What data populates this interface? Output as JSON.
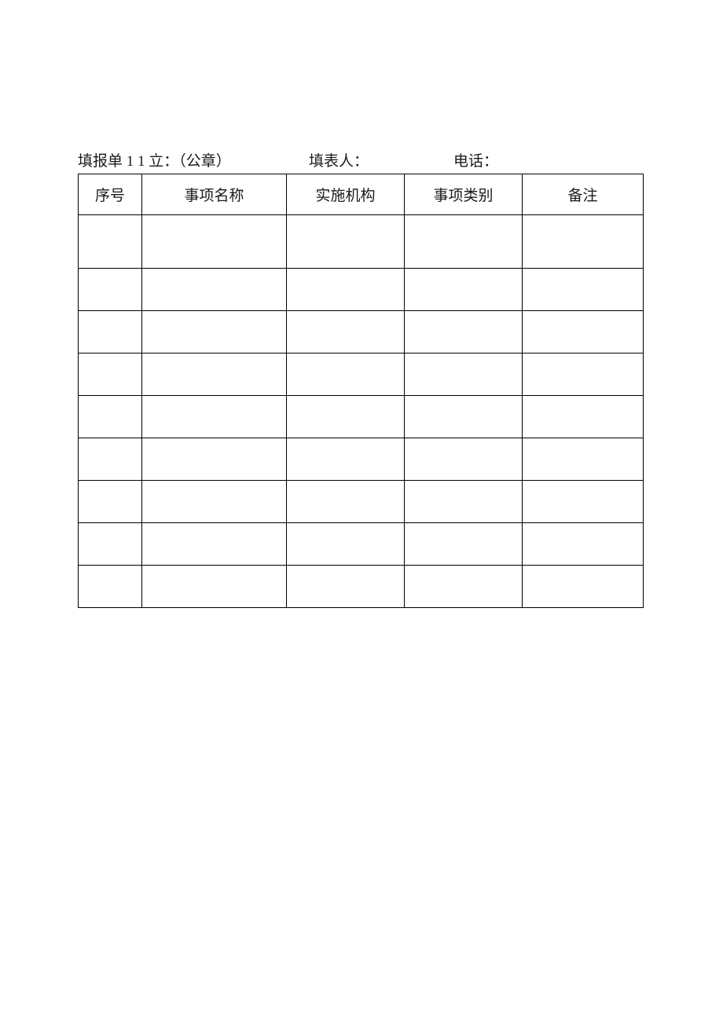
{
  "header": {
    "unit_label": "填报单 1 1 立：（公章）",
    "person_label": "填表人：",
    "phone_label": "电话："
  },
  "table": {
    "columns": [
      "序号",
      "事项名称",
      "实施机构",
      "事项类别",
      "备注"
    ],
    "rows": [
      [
        "",
        "",
        "",
        "",
        ""
      ],
      [
        "",
        "",
        "",
        "",
        ""
      ],
      [
        "",
        "",
        "",
        "",
        ""
      ],
      [
        "",
        "",
        "",
        "",
        ""
      ],
      [
        "",
        "",
        "",
        "",
        ""
      ],
      [
        "",
        "",
        "",
        "",
        ""
      ],
      [
        "",
        "",
        "",
        "",
        ""
      ],
      [
        "",
        "",
        "",
        "",
        ""
      ],
      [
        "",
        "",
        "",
        "",
        ""
      ]
    ]
  }
}
